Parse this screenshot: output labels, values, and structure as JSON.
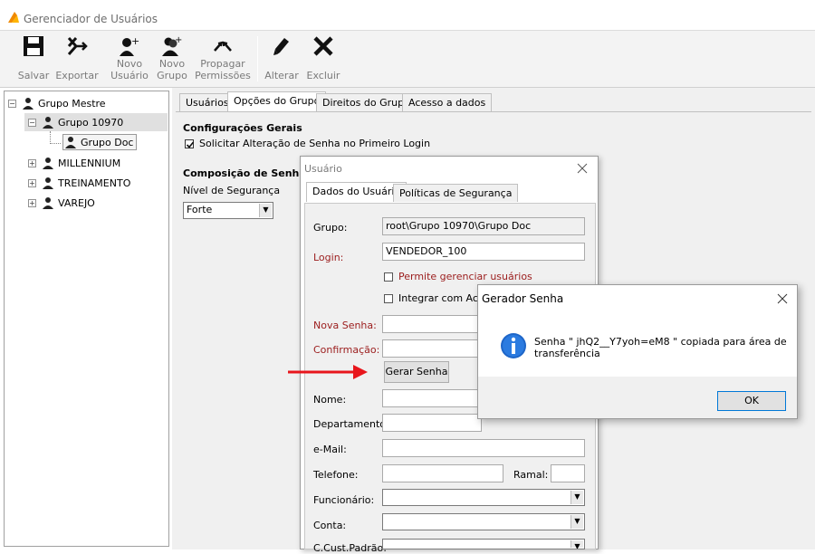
{
  "window": {
    "title": "Gerenciador de Usuários"
  },
  "toolbar": {
    "buttons": [
      {
        "id": "save",
        "line1": "",
        "line2": "Salvar",
        "icon": "floppy-disk-icon"
      },
      {
        "id": "export",
        "line1": "",
        "line2": "Exportar",
        "icon": "export-icon"
      },
      {
        "id": "new-user",
        "line1": "Novo",
        "line2": "Usuário",
        "icon": "new-user-icon"
      },
      {
        "id": "new-group",
        "line1": "Novo",
        "line2": "Grupo",
        "icon": "new-group-icon"
      },
      {
        "id": "propagate",
        "line1": "Propagar",
        "line2": "Permissões",
        "icon": "propagate-icon"
      },
      {
        "id": "edit",
        "line1": "",
        "line2": "Alterar",
        "icon": "pencil-icon"
      },
      {
        "id": "delete",
        "line1": "",
        "line2": "Excluir",
        "icon": "x-icon"
      }
    ]
  },
  "tree": {
    "items": [
      {
        "label": "Grupo Mestre",
        "expander": "−"
      },
      {
        "label": "Grupo 10970",
        "expander": "−"
      },
      {
        "label": "Grupo Doc",
        "expander": ""
      },
      {
        "label": "MILLENNIUM",
        "expander": "+"
      },
      {
        "label": "TREINAMENTO",
        "expander": "+"
      },
      {
        "label": "VAREJO",
        "expander": "+"
      }
    ]
  },
  "main": {
    "tabs": [
      "Usuários",
      "Opções do Grupo",
      "Direitos do Grupo",
      "Acesso a dados"
    ],
    "general_title": "Configurações Gerais",
    "require_password_change": "Solicitar Alteração de Senha no Primeiro Login",
    "composition_title": "Composição de Senha",
    "security_level_label": "Nível de Segurança",
    "security_level_value": "Forte"
  },
  "user_dialog": {
    "title": "Usuário",
    "tabs": [
      "Dados do Usuário",
      "Políticas de Segurança"
    ],
    "group_label": "Grupo:",
    "group_value": "root\\Grupo 10970\\Grupo Doc",
    "login_label": "Login:",
    "login_value": "VENDEDOR_100",
    "manage_users": "Permite gerenciar usuários",
    "integrate": "Integrar com Activ",
    "new_password_label": "Nova Senha:",
    "confirm_label": "Confirmação:",
    "generate_button": "Gerar Senha",
    "name_label": "Nome:",
    "department_label": "Departamento:",
    "email_label": "e-Mail:",
    "phone_label": "Telefone:",
    "extension_label": "Ramal:",
    "employee_label": "Funcionário:",
    "account_label": "Conta:",
    "cost_center_label": "C.Cust.Padrão:"
  },
  "generator_dialog": {
    "title": "Gerador Senha",
    "message_line1": "Senha \" jhQ2__Y7yoh=eM8 \" copiada para área de",
    "message_line2": "transferência",
    "ok": "OK"
  },
  "colors": {
    "accent_red": "#e8161c",
    "info_blue": "#1e66c8",
    "label_red": "#9b1c1c"
  }
}
